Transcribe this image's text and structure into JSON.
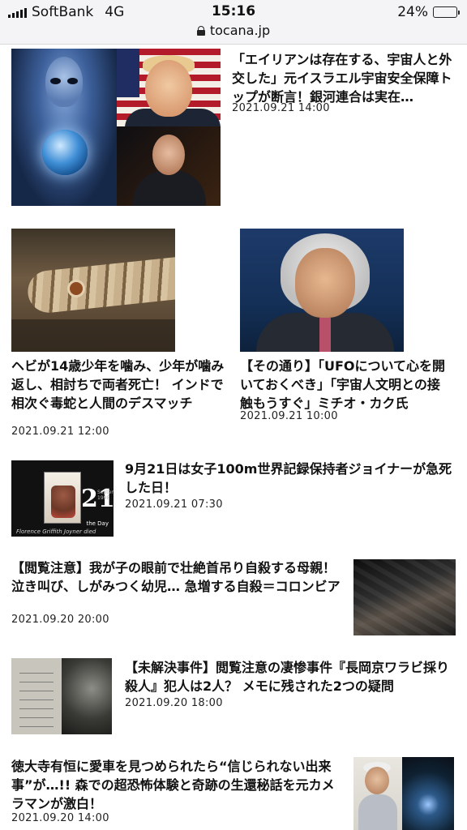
{
  "status_bar": {
    "carrier": "SoftBank",
    "network": "4G",
    "time": "15:16",
    "battery": "24%",
    "battery_level": 0.24
  },
  "url_bar": {
    "url": "tocana.jp"
  },
  "articles": [
    {
      "title": "「エイリアンは存在する、宇宙人と外交した」元イスラエル宇宙安全保障トップが断言！銀河連合は実在…",
      "date": "2021.09.21 14:00"
    },
    {
      "title": "ヘビが14歳少年を噛み、少年が噛み返し、相討ちで両者死亡！ インドで相次ぐ毒蛇と人間のデスマッチ",
      "date": "2021.09.21 12:00"
    },
    {
      "title": "【その通り】「UFOについて心を開いておくべき」「宇宙人文明との接触もうすぐ」ミチオ・カク氏",
      "date": "2021.09.21 10:00"
    },
    {
      "title": "9月21日は女子100m世界記録保持者ジョイナーが急死した日！",
      "date": "2021.09.21 07:30",
      "thumb_number": "21",
      "thumb_sub": "September 1998",
      "thumb_caption1": "the Day",
      "thumb_caption2": "Florence Griffith Joyner died"
    },
    {
      "title": "【閲覧注意】我が子の眼前で壮絶首吊り自殺する母親！ 泣き叫び、しがみつく幼児… 急増する自殺＝コロンビア",
      "date": "2021.09.20 20:00"
    },
    {
      "title": "【未解決事件】閲覧注意の凄惨事件『長岡京ワラビ採り殺人』犯人は2人？ メモに残された2つの疑問",
      "date": "2021.09.20 18:00"
    },
    {
      "title": "徳大寺有恒に愛車を見つめられたら“信じられない出来事”が…!! 森での超恐怖体験と奇跡の生還秘話を元カメラマンが激白！",
      "date": "2021.09.20 14:00"
    }
  ]
}
